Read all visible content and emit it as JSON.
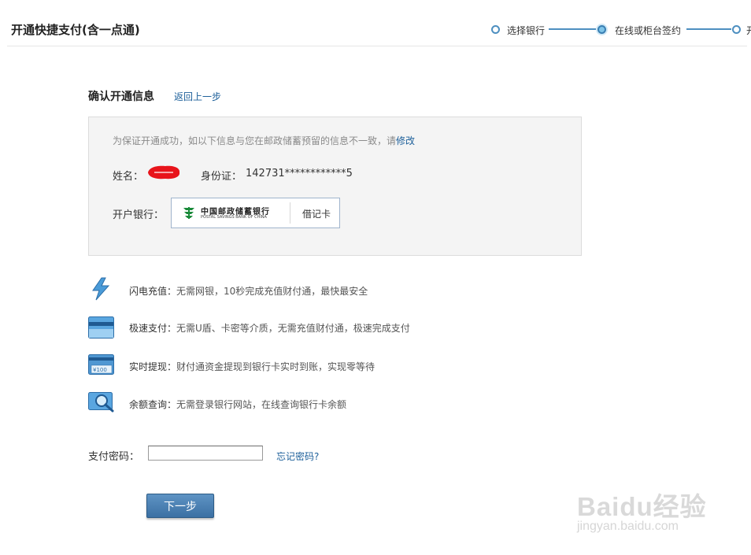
{
  "header": {
    "title": "开通快捷支付(含一点通)",
    "steps": [
      {
        "label": "选择银行",
        "state": "done"
      },
      {
        "label": "在线或柜台签约",
        "state": "current"
      },
      {
        "label": "开",
        "state": "pending"
      }
    ]
  },
  "confirm": {
    "title": "确认开通信息",
    "back_link": "返回上一步",
    "notice_prefix": "为保证开通成功，如以下信息与您在邮政储蓄预留的信息不一致，请",
    "notice_link": "修改",
    "name_label": "姓名：",
    "id_label": "身份证：",
    "id_value": "142731************5",
    "bank_label": "开户银行：",
    "bank_name_cn": "中国邮政储蓄银行",
    "bank_name_en": "POSTAL SAVINGS BANK OF CHINA",
    "card_type": "借记卡"
  },
  "features": [
    {
      "icon": "lightning-icon",
      "title": "闪电充值：",
      "desc": "无需网银，10秒完成充值财付通，最快最安全"
    },
    {
      "icon": "card-icon",
      "title": "极速支付：",
      "desc": "无需U盾、卡密等介质，无需充值财付通，极速完成支付"
    },
    {
      "icon": "banknote-icon",
      "title": "实时提现：",
      "desc": "财付通资金提现到银行卡实时到账，实现零等待"
    },
    {
      "icon": "magnifier-icon",
      "title": "余额查询：",
      "desc": "无需登录银行网站，在线查询银行卡余额"
    }
  ],
  "payment": {
    "password_label": "支付密码：",
    "password_value": "",
    "forgot_link": "忘记密码?",
    "next_button": "下一步"
  },
  "watermark": {
    "main": "Baidu经验",
    "sub": "jingyan.baidu.com"
  },
  "colors": {
    "accent": "#1c5f9a",
    "step_line": "#4d8fc0",
    "button": "#3b70a3",
    "redaction": "#e8141b",
    "bank_green": "#1a8a3a"
  }
}
